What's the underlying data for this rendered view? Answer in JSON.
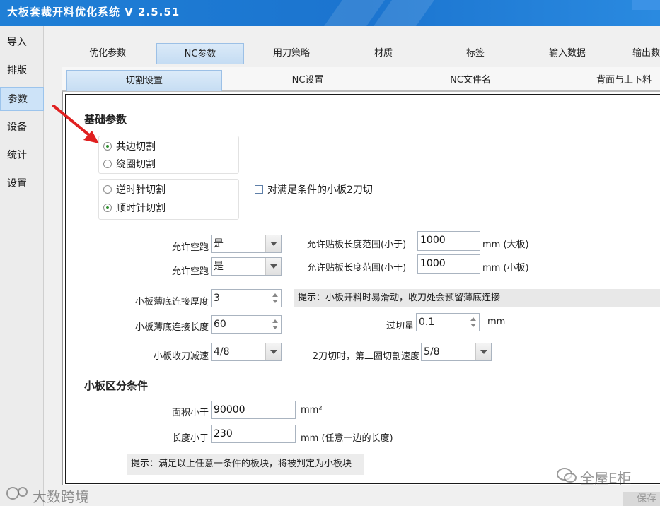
{
  "app": {
    "title": "大板套裁开料优化系统 V 2.5.51"
  },
  "sidebar": {
    "items": [
      {
        "label": "导入"
      },
      {
        "label": "排版"
      },
      {
        "label": "参数",
        "active": true
      },
      {
        "label": "设备"
      },
      {
        "label": "统计"
      },
      {
        "label": "设置"
      }
    ]
  },
  "tabs": [
    {
      "label": "优化参数"
    },
    {
      "label": "NC参数",
      "active": true
    },
    {
      "label": "用刀策略"
    },
    {
      "label": "材质"
    },
    {
      "label": "标签"
    },
    {
      "label": "输入数据"
    },
    {
      "label": "输出数"
    }
  ],
  "subtabs": [
    {
      "label": "切割设置",
      "active": true
    },
    {
      "label": "NC设置"
    },
    {
      "label": "NC文件名"
    },
    {
      "label": "背面与上下料"
    }
  ],
  "basic": {
    "heading": "基础参数",
    "cut_mode": {
      "options": [
        {
          "label": "共边切割",
          "checked": true
        },
        {
          "label": "绕圈切割",
          "checked": false
        }
      ]
    },
    "direction": {
      "options": [
        {
          "label": "逆时针切割",
          "checked": false
        },
        {
          "label": "顺时针切割",
          "checked": true
        }
      ]
    },
    "two_cut": {
      "label": "对满足条件的小板2刀切",
      "checked": false
    },
    "allow_idle_1": {
      "label": "允许空跑",
      "value": "是"
    },
    "allow_idle_2": {
      "label": "允许空跑",
      "value": "是"
    },
    "stick_range_1": {
      "label": "允许贴板长度范围(小于)",
      "value": "1000",
      "unit": "mm (大板)"
    },
    "stick_range_2": {
      "label": "允许贴板长度范围(小于)",
      "value": "1000",
      "unit": "mm (小板)"
    },
    "thin_thickness": {
      "label": "小板薄底连接厚度",
      "value": "3"
    },
    "thin_length": {
      "label": "小板薄底连接长度",
      "value": "60"
    },
    "hint_slip": "提示：小板开料时易滑动，收刀处会预留薄底连接",
    "overcut": {
      "label": "过切量",
      "value": "0.1",
      "unit": "mm"
    },
    "slowdown": {
      "label": "小板收刀减速",
      "value": "4/8"
    },
    "second_speed": {
      "label": "2刀切时，第二圈切割速度",
      "value": "5/8"
    }
  },
  "small": {
    "heading": "小板区分条件",
    "area": {
      "label": "面积小于",
      "value": "90000",
      "unit": "mm²"
    },
    "length": {
      "label": "长度小于",
      "value": "230",
      "unit": "mm (任意一边的长度)"
    },
    "hint": "提示：满足以上任意一条件的板块，将被判定为小板块"
  },
  "footer": {
    "save_label": "保存",
    "watermark_left": "大数跨境",
    "watermark_right": "全屋E柜"
  },
  "colors": {
    "title_bar": "#1f7fd6",
    "active_tab": "#c4dcf3",
    "arrow": "#e02020"
  }
}
